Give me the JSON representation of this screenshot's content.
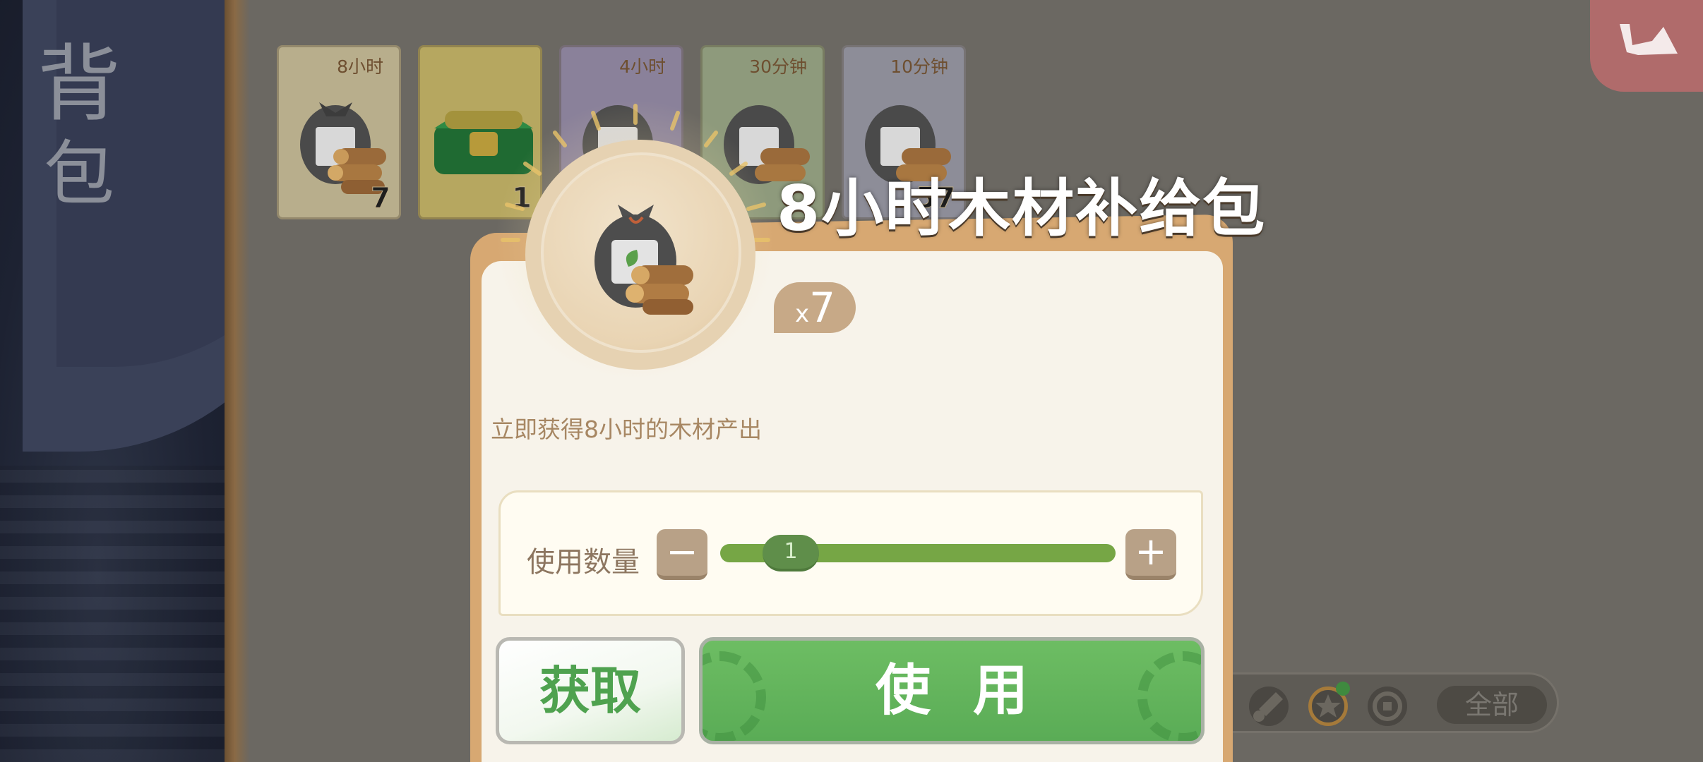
{
  "sidebar": {
    "title_line1": "背",
    "title_line2": "包"
  },
  "inventory": [
    {
      "label": "8小时",
      "count": "7",
      "bg": "#b8ae8c",
      "icon": "wood-bag-icon"
    },
    {
      "label": "",
      "count": "1",
      "bg": "#b6a760",
      "icon": "green-chest-icon"
    },
    {
      "label": "4小时",
      "count": "",
      "bg": "#8a819a",
      "icon": "wood-bag-icon"
    },
    {
      "label": "30分钟",
      "count": "",
      "bg": "#8e9a7c",
      "icon": "wood-bag-icon"
    },
    {
      "label": "10分钟",
      "count": "57",
      "bg": "#8d8d98",
      "icon": "wood-bag-icon"
    }
  ],
  "dialog": {
    "title": "8小时木材补给包",
    "qty_x": "x",
    "qty_value": "7",
    "description": "立即获得8小时的木材产出",
    "use_qty_label": "使用数量",
    "minus": "−",
    "plus": "+",
    "slider_value": "1",
    "get_button": "获取",
    "use_button": "使用"
  },
  "filter_bar": {
    "all_label": "全部"
  },
  "colors": {
    "accent_green": "#5aac56",
    "frame_tan": "#d7a872",
    "exit_red": "#b06b6b"
  }
}
